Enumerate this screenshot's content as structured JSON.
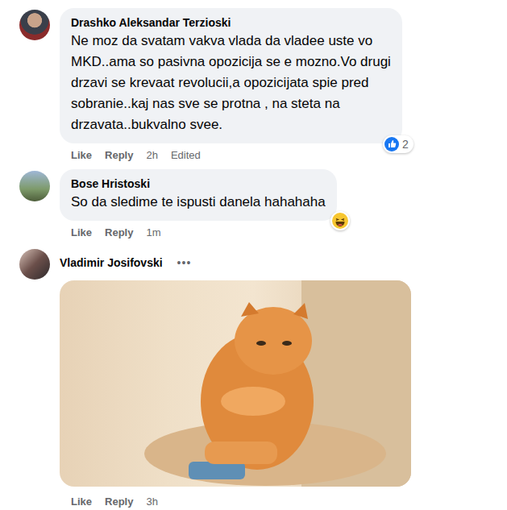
{
  "comments": [
    {
      "kind": "text",
      "author": "Drashko Aleksandar Terzioski",
      "text_lines": [
        "Ne moz da svatam vakva vlada da vladee uste vo",
        "MKD..ama so pasivna opozicija se e mozno.Vo drugi",
        "drzavi se krevaat revolucii,a opozicijata spie pred",
        "sobranie..kaj nas sve se protna , na steta na",
        "drzavata..bukvalno svee."
      ],
      "actions": [
        "Like",
        "Reply"
      ],
      "time": "2h",
      "edited": "Edited",
      "reaction": {
        "kind": "like",
        "count": "2"
      }
    },
    {
      "kind": "text",
      "author": "Bose Hristoski",
      "text_lines": [
        "So da sledime te ispusti danela hahahaha"
      ],
      "actions": [
        "Like",
        "Reply"
      ],
      "time": "1m",
      "reaction": {
        "kind": "haha"
      }
    },
    {
      "kind": "gif",
      "author": "Vladimir Josifovski",
      "menu": "•••",
      "actions": [
        "Like",
        "Reply"
      ],
      "time": "3h"
    }
  ]
}
